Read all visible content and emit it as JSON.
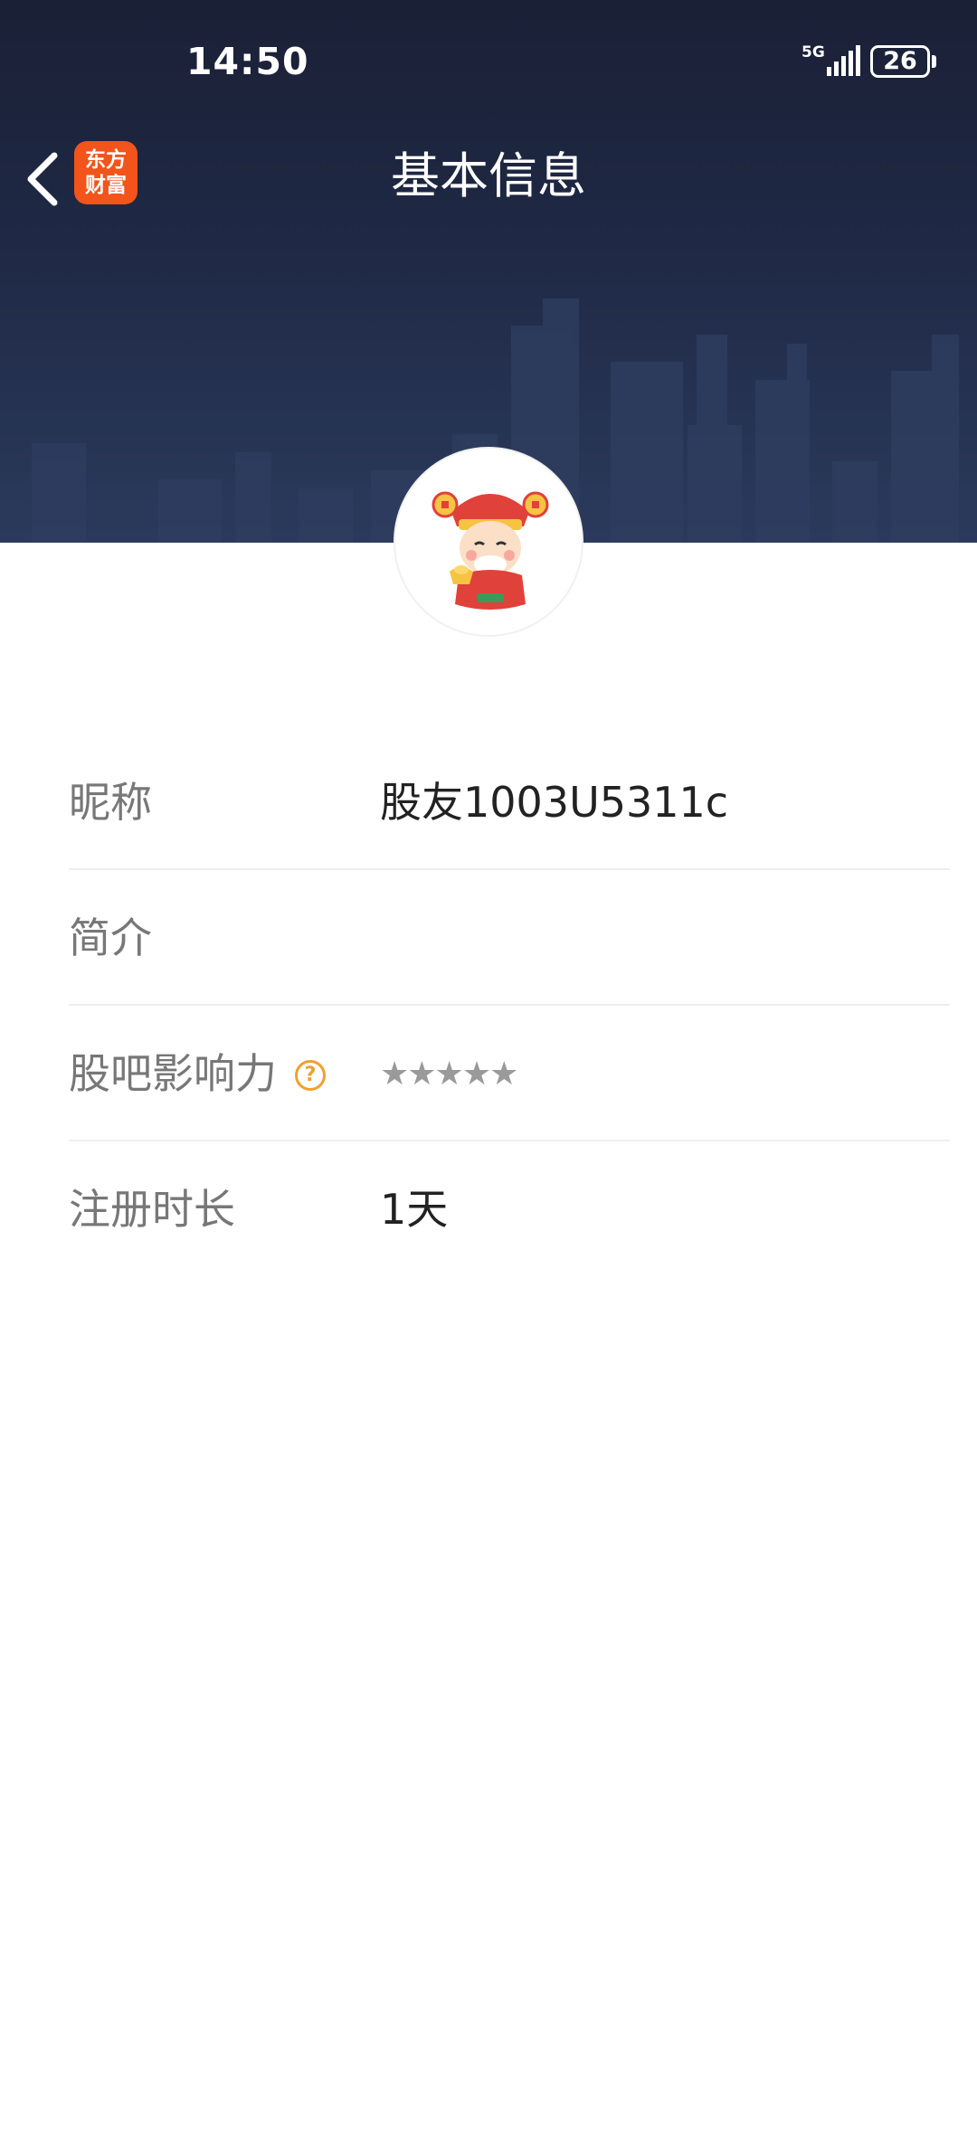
{
  "status_bar": {
    "time": "14:50",
    "network": "5G",
    "battery": "26"
  },
  "nav": {
    "back_icon": "chevron-left-icon",
    "logo_text_line1": "东方",
    "logo_text_line2": "财富",
    "title": "基本信息"
  },
  "colors": {
    "header_bg": "#1f2945",
    "logo_orange": "#f2541b",
    "help_icon": "#f0a030",
    "label_gray": "#777777",
    "value_dark": "#222222"
  },
  "profile": {
    "avatar": "avatar-god-of-wealth-icon",
    "rows": [
      {
        "label": "昵称",
        "value": "股友1003U5311c"
      },
      {
        "label": "简介",
        "value": ""
      },
      {
        "label": "股吧影响力",
        "value": "★★★★★",
        "help_icon": "question-circle-icon",
        "rating_filled": 0,
        "rating_max": 5
      },
      {
        "label": "注册时长",
        "value": "1天"
      }
    ]
  }
}
